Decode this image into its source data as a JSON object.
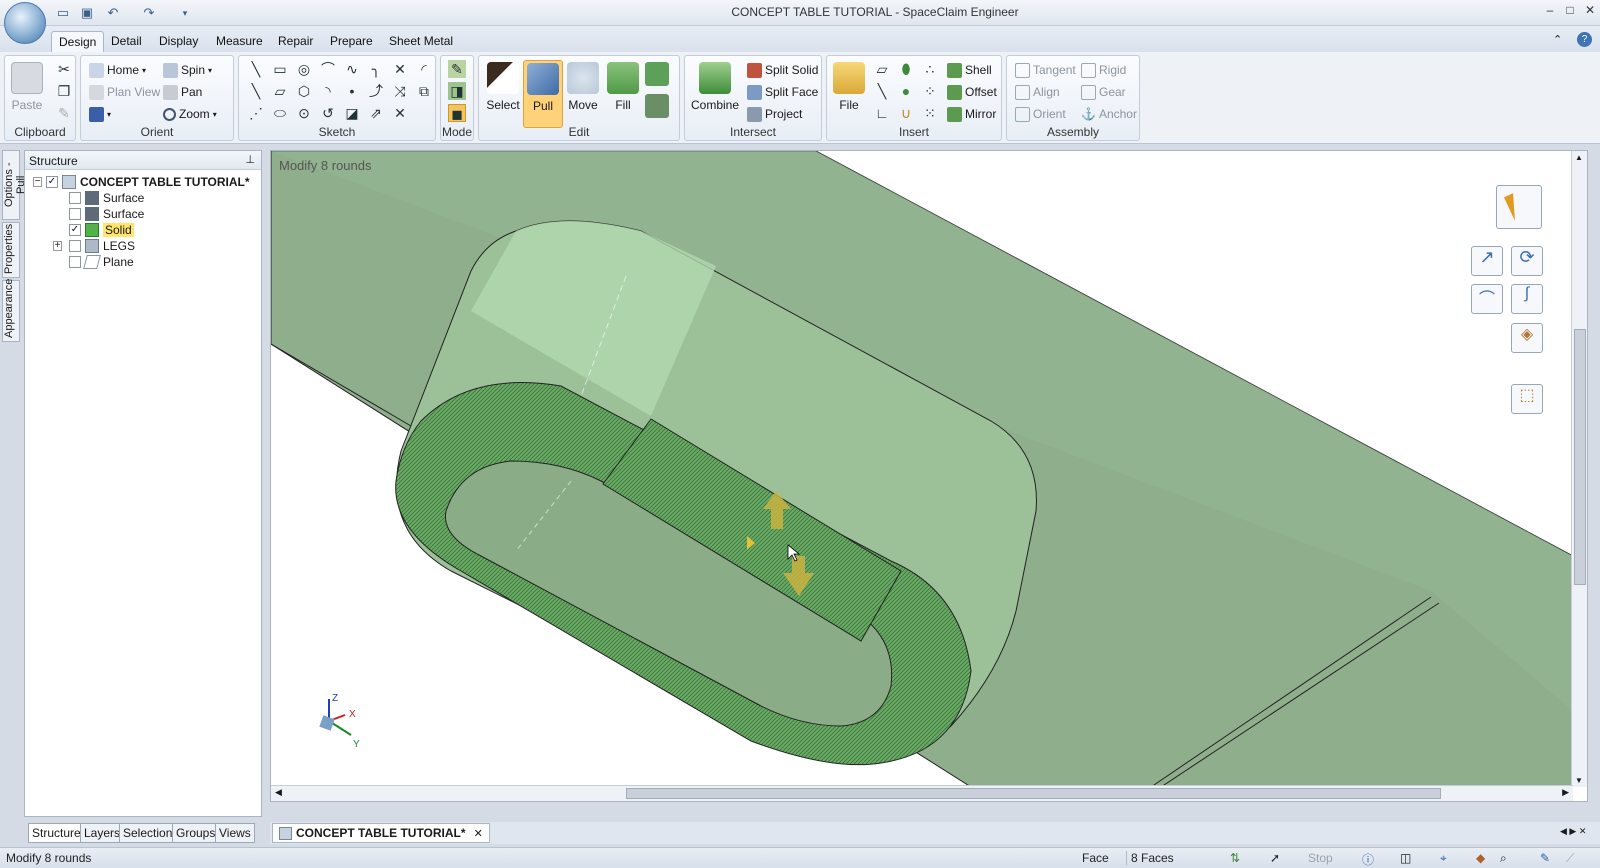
{
  "window": {
    "title": "CONCEPT TABLE TUTORIAL - SpaceClaim Engineer"
  },
  "tabs": [
    "Design",
    "Detail",
    "Display",
    "Measure",
    "Repair",
    "Prepare",
    "Sheet Metal"
  ],
  "ribbon": {
    "clipboard": {
      "label": "Clipboard",
      "paste": "Paste"
    },
    "orient": {
      "label": "Orient",
      "home": "Home",
      "plan_view": "Plan View",
      "spin": "Spin",
      "pan": "Pan",
      "zoom": "Zoom"
    },
    "sketch": {
      "label": "Sketch"
    },
    "mode": {
      "label": "Mode"
    },
    "edit": {
      "label": "Edit",
      "select": "Select",
      "pull": "Pull",
      "move": "Move",
      "fill": "Fill"
    },
    "intersect": {
      "label": "Intersect",
      "combine": "Combine",
      "split_solid": "Split Solid",
      "split_face": "Split Face",
      "project": "Project"
    },
    "insert": {
      "label": "Insert",
      "file": "File",
      "shell": "Shell",
      "offset": "Offset",
      "mirror": "Mirror"
    },
    "assembly": {
      "label": "Assembly",
      "tangent": "Tangent",
      "align": "Align",
      "orient": "Orient",
      "rigid": "Rigid",
      "gear": "Gear",
      "anchor": "Anchor"
    }
  },
  "side_tabs": [
    "Options - Pull",
    "Properties",
    "Appearance"
  ],
  "structure": {
    "header": "Structure",
    "root": "CONCEPT TABLE TUTORIAL*",
    "items": [
      {
        "label": "Surface",
        "checked": false
      },
      {
        "label": "Surface",
        "checked": false
      },
      {
        "label": "Solid",
        "checked": true
      },
      {
        "label": "LEGS",
        "checked": false
      },
      {
        "label": "Plane",
        "checked": false
      }
    ]
  },
  "panel_tabs": [
    "Structure",
    "Layers",
    "Selection",
    "Groups",
    "Views"
  ],
  "viewport": {
    "status": "Modify 8 rounds",
    "axes": {
      "x": "X",
      "y": "Y",
      "z": "Z"
    }
  },
  "doc_tab": "CONCEPT TABLE TUTORIAL*",
  "statusbar": {
    "message": "Modify 8 rounds",
    "select_type": "Face",
    "selection": "8 Faces",
    "stop": "Stop"
  },
  "colors": {
    "model_green": "#8fb48c",
    "selection_green": "#2f8a2f",
    "pull_active": "#ffd27a"
  }
}
